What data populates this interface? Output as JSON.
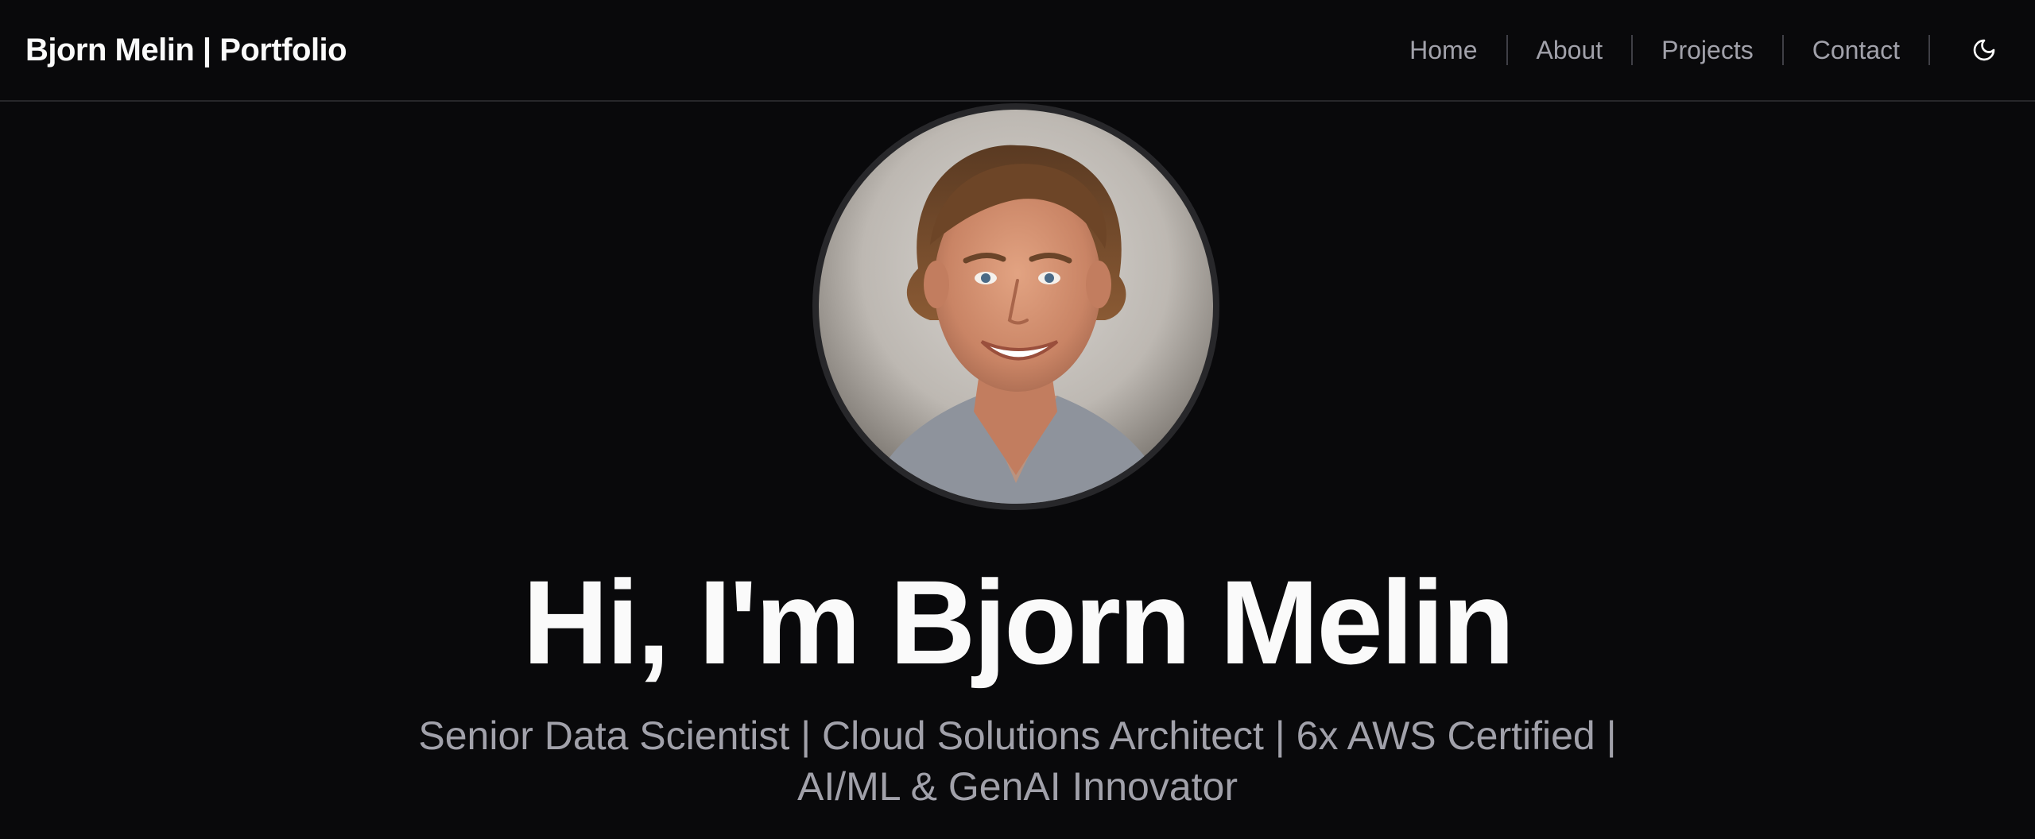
{
  "header": {
    "brand": "Bjorn Melin | Portfolio",
    "nav_items": [
      {
        "label": "Home"
      },
      {
        "label": "About"
      },
      {
        "label": "Projects"
      },
      {
        "label": "Contact"
      }
    ],
    "theme_toggle_icon": "moon-icon"
  },
  "hero": {
    "avatar_icon": "profile-photo",
    "headline": "Hi, I'm Bjorn Melin",
    "subtitle": "Senior Data Scientist | Cloud Solutions Architect | 6x AWS Certified | AI/ML & GenAI Innovator"
  },
  "colors": {
    "background": "#09090b",
    "text_primary": "#fafafa",
    "text_muted": "#a1a1aa",
    "border": "#27272a"
  }
}
